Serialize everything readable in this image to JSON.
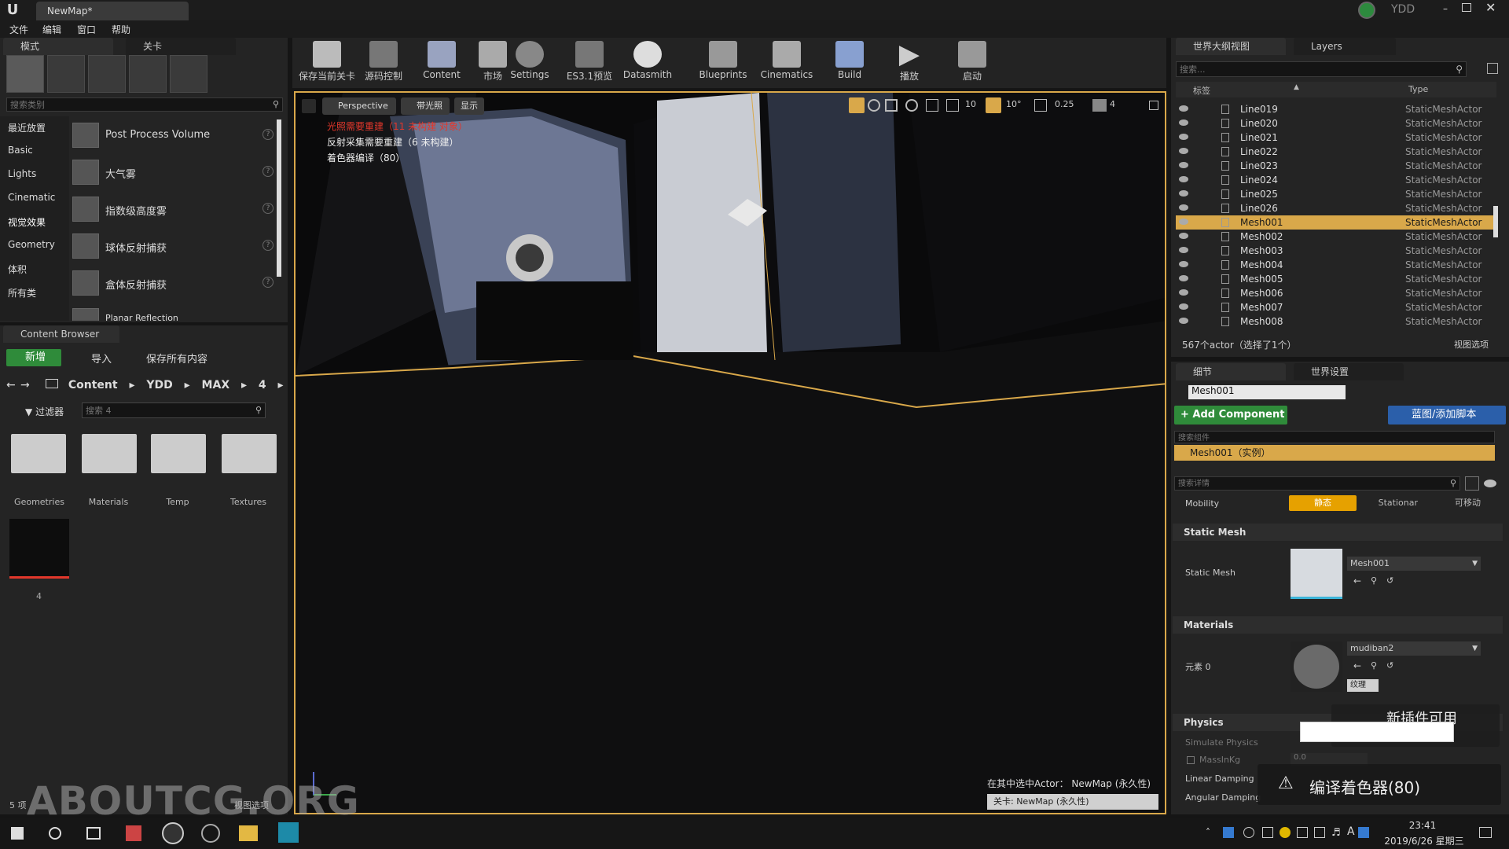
{
  "titlebar": {
    "tab_title": "NewMap*",
    "user": "YDD"
  },
  "menu": [
    "文件",
    "编辑",
    "窗口",
    "帮助"
  ],
  "modes_panel": {
    "tabs": [
      "模式",
      "关卡"
    ],
    "search_placeholder": "搜索类别",
    "categories": [
      "最近放置",
      "Basic",
      "Lights",
      "Cinematic",
      "视觉效果",
      "Geometry",
      "体积",
      "所有类"
    ],
    "items": [
      "Post Process Volume",
      "大气雾",
      "指数级高度雾",
      "球体反射捕获",
      "盒体反射捕获",
      "Planar Reflection"
    ]
  },
  "content_browser": {
    "tab": "Content Browser",
    "new_label": "新增",
    "import_label": "导入",
    "save_all_label": "保存所有内容",
    "path": [
      "Content",
      "YDD",
      "MAX",
      "4"
    ],
    "filter_label": "过滤器",
    "search_placeholder": "搜索 4",
    "folders": [
      "Geometries",
      "Materials",
      "Temp",
      "Textures"
    ],
    "asset_label": "4",
    "footer_count": "5 项",
    "footer_view": "视图选项"
  },
  "toolbar": [
    "保存当前关卡",
    "源码控制",
    "Content",
    "市场",
    "Settings",
    "ES3.1预览",
    "Datasmith",
    "Blueprints",
    "Cinematics",
    "Build",
    "播放",
    "启动"
  ],
  "viewport": {
    "perspective": "Perspective",
    "lit": "带光照",
    "show": "显示",
    "snap_grid": "10",
    "snap_rot": "10°",
    "snap_scale": "0.25",
    "cam_speed": "4",
    "warning1": "光照需要重建（11 未构建 对象）",
    "warning2": "反射采集需要重建（6 未构建）",
    "warning3": "着色器编译（80）",
    "selected_actor": "在其中选中Actor： NewMap (永久性)",
    "level": "关卡: NewMap (永久性)"
  },
  "outliner": {
    "tabs": [
      "世界大纲视图",
      "Layers"
    ],
    "search_placeholder": "搜索...",
    "col_label": "标签",
    "col_type": "Type",
    "rows": [
      {
        "name": "Line019",
        "type": "StaticMeshActor"
      },
      {
        "name": "Line020",
        "type": "StaticMeshActor"
      },
      {
        "name": "Line021",
        "type": "StaticMeshActor"
      },
      {
        "name": "Line022",
        "type": "StaticMeshActor"
      },
      {
        "name": "Line023",
        "type": "StaticMeshActor"
      },
      {
        "name": "Line024",
        "type": "StaticMeshActor"
      },
      {
        "name": "Line025",
        "type": "StaticMeshActor"
      },
      {
        "name": "Line026",
        "type": "StaticMeshActor"
      },
      {
        "name": "Mesh001",
        "type": "StaticMeshActor"
      },
      {
        "name": "Mesh002",
        "type": "StaticMeshActor"
      },
      {
        "name": "Mesh003",
        "type": "StaticMeshActor"
      },
      {
        "name": "Mesh004",
        "type": "StaticMeshActor"
      },
      {
        "name": "Mesh005",
        "type": "StaticMeshActor"
      },
      {
        "name": "Mesh006",
        "type": "StaticMeshActor"
      },
      {
        "name": "Mesh007",
        "type": "StaticMeshActor"
      },
      {
        "name": "Mesh008",
        "type": "StaticMeshActor"
      }
    ],
    "footer": "567个actor（选择了1个）",
    "view_options": "视图选项"
  },
  "details": {
    "tabs": [
      "细节",
      "世界设置"
    ],
    "name_value": "Mesh001",
    "add_component": "+ Add Component",
    "blueprint_btn": "蓝图/添加脚本",
    "search_components": "搜索组件",
    "instance_row": "Mesh001（实例）",
    "search_details": "搜索详情",
    "mobility_label": "Mobility",
    "mobility_options": [
      "静态",
      "Stationar",
      "可移动"
    ],
    "static_mesh_section": "Static Mesh",
    "static_mesh_label": "Static Mesh",
    "static_mesh_value": "Mesh001",
    "materials_section": "Materials",
    "element0_label": "元素 0",
    "material_value": "mudiban2",
    "texture_label": "纹理",
    "physics_section": "Physics",
    "simulate_physics": "Simulate Physics",
    "mass_label": "MassInKg",
    "mass_value": "0.0",
    "linear_damping": "Linear Damping",
    "angular_damping": "Angular Damping"
  },
  "notifications": {
    "plugin": "新插件可用",
    "compile": "编译着色器(80)"
  },
  "watermark": "ABOUTCG.ORG",
  "taskbar": {
    "time": "23:41",
    "date": "2019/6/26 星期三",
    "ime": "A"
  },
  "colors": {
    "accent": "#d9a84a",
    "selected_row": "#d9a84a",
    "add_component": "#2f8b3a",
    "blueprint": "#2b5faa",
    "warning_red": "#e2372b"
  }
}
